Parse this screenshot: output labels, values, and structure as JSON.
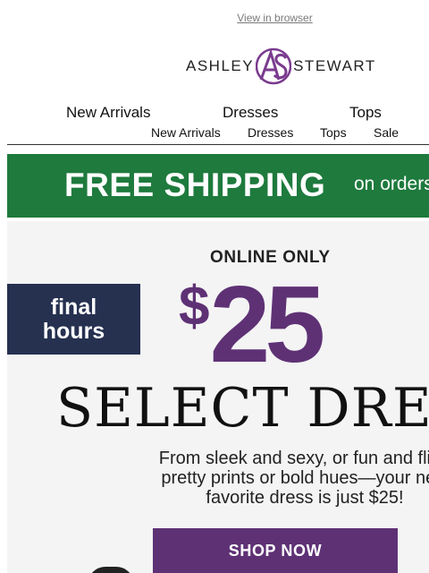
{
  "header": {
    "view_in_browser": "View in browser",
    "logo": {
      "left_word": "ASHLEY",
      "right_word": "STEWART",
      "monogram": "AS",
      "colors": {
        "monogram": "#7a3b8f",
        "wordmark": "#222222"
      }
    }
  },
  "nav_primary": {
    "items": [
      "New Arrivals",
      "Dresses",
      "Tops"
    ]
  },
  "nav_secondary": {
    "items": [
      "New Arrivals",
      "Dresses",
      "Tops",
      "Sale"
    ]
  },
  "shipping_banner": {
    "headline": "FREE SHIPPING",
    "subtext": "on orders",
    "color": "#1e7a3d"
  },
  "promo": {
    "eyebrow": "ONLINE ONLY",
    "badge": {
      "line1": "final",
      "line2": "hours",
      "color": "#263150"
    },
    "price": {
      "currency": "$",
      "amount": "25",
      "color": "#5e3175"
    },
    "headline": "SELECT DRESSES",
    "description": [
      "From sleek and sexy, or fun and flirty",
      "pretty prints or bold hues—your new",
      "favorite dress is just $25!"
    ],
    "cta_label": "SHOP NOW",
    "cta_color": "#5e3175"
  }
}
